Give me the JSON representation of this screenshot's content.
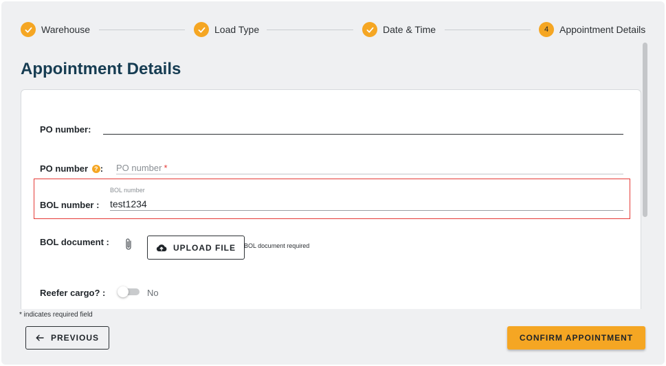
{
  "stepper": {
    "steps": [
      {
        "label": "Warehouse",
        "state": "complete",
        "icon": "check-icon"
      },
      {
        "label": "Load Type",
        "state": "complete",
        "icon": "check-icon"
      },
      {
        "label": "Date & Time",
        "state": "complete",
        "icon": "check-icon"
      },
      {
        "label": "Appointment Details",
        "state": "active",
        "number": "4"
      }
    ],
    "accent_color": "#f5a623"
  },
  "page": {
    "title": "Appointment Details"
  },
  "form": {
    "po_number_1": {
      "label": "PO number:",
      "value": ""
    },
    "po_number_2": {
      "label": "PO number",
      "help_icon": "question-circle-icon",
      "help_text": "?",
      "colon": ":",
      "placeholder": "PO number",
      "required_mark": "*"
    },
    "bol_number": {
      "label": "BOL number :",
      "floating_label": "BOL number",
      "value": "test1234"
    },
    "bol_document": {
      "label": "BOL document :",
      "attach_icon": "paperclip-icon",
      "upload_label": "UPLOAD FILE",
      "upload_icon": "cloud-upload-icon",
      "hint": "BOL document required"
    },
    "reefer_cargo": {
      "label": "Reefer cargo? :",
      "toggle_on": false,
      "toggle_text": "No"
    }
  },
  "footer": {
    "required_note": "* indicates required field",
    "previous_label": "PREVIOUS",
    "previous_icon": "arrow-left-icon",
    "confirm_label": "CONFIRM APPOINTMENT"
  },
  "highlight_color": "#e53935"
}
